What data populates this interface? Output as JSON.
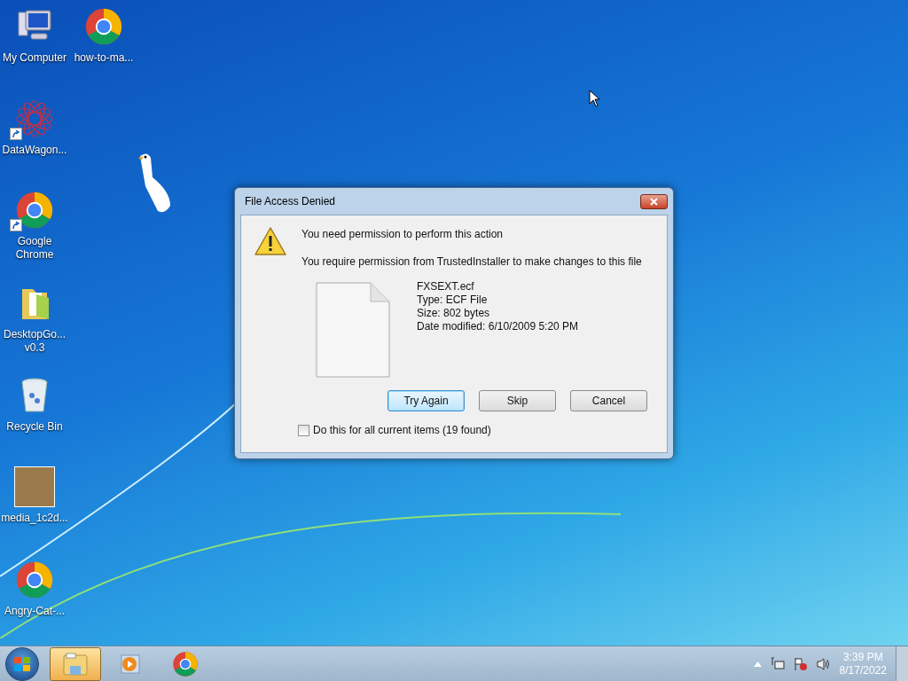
{
  "desktop_icons": [
    {
      "kind": "computer",
      "label": "My Computer",
      "shortcut": false
    },
    {
      "kind": "chrome",
      "label": "how-to-ma...",
      "shortcut": false
    },
    {
      "kind": "datawagon",
      "label": "DataWagon...",
      "shortcut": true
    },
    {
      "kind": "chrome",
      "label": "Google Chrome",
      "shortcut": true
    },
    {
      "kind": "folder",
      "label": "DesktopGo... v0.3",
      "shortcut": false
    },
    {
      "kind": "recycle",
      "label": "Recycle Bin",
      "shortcut": false
    },
    {
      "kind": "image",
      "label": "media_1c2d...",
      "shortcut": false
    },
    {
      "kind": "chrome",
      "label": "Angry-Cat-...",
      "shortcut": false
    }
  ],
  "dialog": {
    "title": "File Access Denied",
    "heading": "You need permission to perform this action",
    "message": "You require permission from TrustedInstaller to make changes to this file",
    "file_lines": [
      "FXSEXT.ecf",
      "Type: ECF File",
      "Size: 802 bytes",
      "Date modified: 6/10/2009 5:20 PM"
    ],
    "buttons": [
      {
        "label": "Try Again",
        "default": true
      },
      {
        "label": "Skip",
        "default": false
      },
      {
        "label": "Cancel",
        "default": false
      }
    ],
    "checkbox": {
      "label": "Do this for all current items (19 found)",
      "checked": false
    }
  },
  "taskbar": {
    "items": [
      {
        "kind": "explorer",
        "selected": true
      },
      {
        "kind": "media",
        "selected": false
      },
      {
        "kind": "chrome",
        "selected": false
      }
    ],
    "time": "3:39 PM",
    "date": "8/17/2022"
  }
}
